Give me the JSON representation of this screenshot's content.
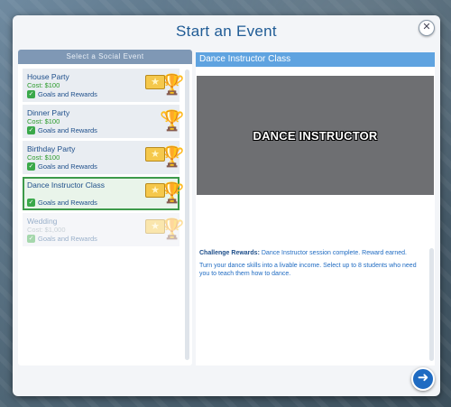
{
  "dialog": {
    "title": "Start an Event",
    "close_icon": "close-icon"
  },
  "left_panel": {
    "header": "Select a Social Event",
    "events": [
      {
        "name": "House Party",
        "cost": "Cost: $100",
        "goals": "Goals and Rewards",
        "state": "normal",
        "star": true
      },
      {
        "name": "Dinner Party",
        "cost": "Cost: $100",
        "goals": "Goals and Rewards",
        "state": "normal",
        "star": false
      },
      {
        "name": "Birthday Party",
        "cost": "Cost: $100",
        "goals": "Goals and Rewards",
        "state": "normal",
        "star": true
      },
      {
        "name": "Dance Instructor Class",
        "cost": "",
        "goals": "Goals and Rewards",
        "state": "selected",
        "star": true
      },
      {
        "name": "Wedding",
        "cost": "Cost: $1,000",
        "goals": "Goals and Rewards",
        "state": "disabled",
        "star": true
      }
    ]
  },
  "right_panel": {
    "header": "Dance Instructor Class",
    "preview_text": "DANCE INSTRUCTOR",
    "challenge_label": "Challenge Rewards:",
    "challenge_text": "Dance Instructor session complete. Reward earned.",
    "description": "Turn your dance skills into a livable income.  Select up to 8 students who need you to teach them how to dance."
  },
  "footer": {
    "next_icon": "arrow-right-icon"
  },
  "colors": {
    "title": "#1f5b95",
    "header_left": "#7f98b5",
    "header_right": "#5fa3e0",
    "cost": "#2a9a2a",
    "selected_border": "#3d9a4a",
    "next_button": "#1f6bc2"
  }
}
